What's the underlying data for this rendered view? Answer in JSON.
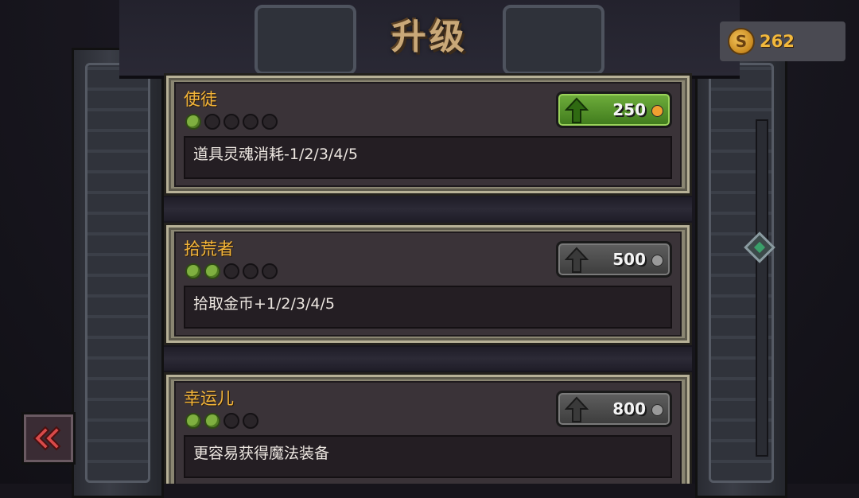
{
  "header": {
    "title": "升级"
  },
  "currency": {
    "icon": "coin-icon",
    "symbol": "S",
    "amount": "262"
  },
  "upgrades": [
    {
      "name": "使徒",
      "level": 1,
      "max_level": 5,
      "description": "道具灵魂消耗-1/2/3/4/5",
      "price": "250",
      "affordable": true
    },
    {
      "name": "拾荒者",
      "level": 2,
      "max_level": 5,
      "description": "拾取金币+1/2/3/4/5",
      "price": "500",
      "affordable": false
    },
    {
      "name": "幸运儿",
      "level": 2,
      "max_level": 4,
      "description": "更容易获得魔法装备",
      "price": "800",
      "affordable": false
    }
  ],
  "colors": {
    "title": "#c9a878",
    "name": "#f3b53a",
    "active_button": "#5a9a2c",
    "inactive_button": "#4c4c4c",
    "level_on": "#7fb040"
  },
  "icons": {
    "back": "back-arrow-icon",
    "upgrade": "upgrade-arrow-icon",
    "scroll": "scroll-handle-icon"
  }
}
